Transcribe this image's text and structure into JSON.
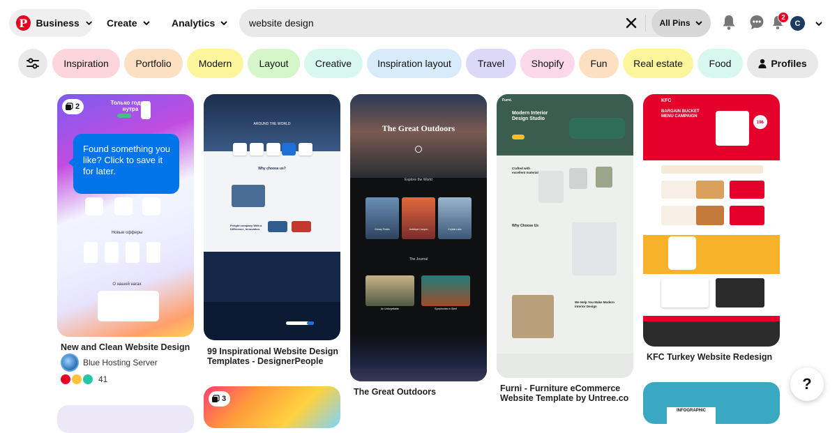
{
  "header": {
    "business_label": "Business",
    "create_label": "Create",
    "analytics_label": "Analytics",
    "search": {
      "value": "website design",
      "placeholder": "Search"
    },
    "scope_label": "All Pins",
    "notifications_badge": "2",
    "avatar_initial": "C"
  },
  "chips": [
    {
      "label": "Inspiration",
      "color": "#fdd5dd"
    },
    {
      "label": "Portfolio",
      "color": "#fde0c2"
    },
    {
      "label": "Modern",
      "color": "#fdf59c"
    },
    {
      "label": "Layout",
      "color": "#d4f6c9"
    },
    {
      "label": "Creative",
      "color": "#d8f8ef"
    },
    {
      "label": "Inspiration layout",
      "color": "#d8ebfb"
    },
    {
      "label": "Travel",
      "color": "#dcd8f8"
    },
    {
      "label": "Shopify",
      "color": "#fbd8ea"
    },
    {
      "label": "Fun",
      "color": "#fde0c2"
    },
    {
      "label": "Real estate",
      "color": "#fdf59c"
    },
    {
      "label": "Food",
      "color": "#d8f8ef"
    },
    {
      "label": "Profiles",
      "color": "#e9e9e9"
    }
  ],
  "tooltip": "Found something you like? Click to save it for later.",
  "pins": [
    {
      "title": "New and Clean Website Design",
      "creator": "Blue Hosting Server",
      "reactions": "41",
      "multi_count": "2",
      "img": {
        "hero": "Только годная нутра",
        "section": "Новые офферы",
        "footer": "О нашей нагах"
      }
    },
    {
      "title": "99 Inspirational Website Design Templates - DesignerPeople",
      "img": {
        "hero": "AROUND THE WORLD",
        "section1": "Why choose us?",
        "section2": "Freight company With a Difference, Innovation."
      }
    },
    {
      "title": "The Great Outdoors",
      "img": {
        "hero": "The Great Outdoors",
        "section1": "Explore the World",
        "section2": "The Journal",
        "cards": [
          "Snowy Peaks",
          "Antelope Canyon",
          "Crystal Lake"
        ],
        "cards2": [
          "An Unforgettable",
          "Symphonies in Steel"
        ]
      }
    },
    {
      "title": "Furni - Furniture eCommerce Website Template by Untree.co",
      "img": {
        "brand": "Furni.",
        "hero": "Modern Interior Design Studio",
        "section1": "Crafted with excellent material.",
        "section2": "Why Choose Us",
        "section3": "We Help You Make Modern Interior Design"
      }
    },
    {
      "title": "KFC Turkey Website Redesign",
      "img": {
        "brand": "KFC",
        "hero": "BARGAIN BUCKET MENU CAMPAIGN",
        "price": "19₺"
      }
    },
    {
      "multi_count": "3"
    },
    {
      "img": {
        "label": "INFOGRAPHIC"
      }
    }
  ],
  "help_label": "?"
}
